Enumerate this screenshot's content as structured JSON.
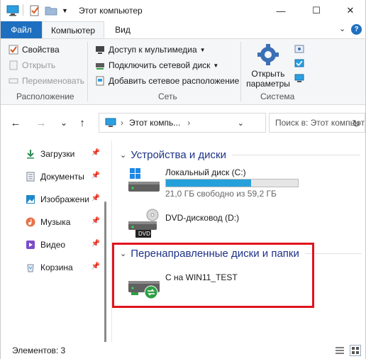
{
  "window": {
    "title": "Этот компьютер",
    "min_glyph": "—",
    "max_glyph": "☐",
    "close_glyph": "✕"
  },
  "ribbon_tabs": {
    "file": "Файл",
    "computer": "Компьютер",
    "view": "Вид",
    "collapse_glyph": "⌄",
    "help_glyph": "?"
  },
  "ribbon": {
    "location": {
      "properties": "Свойства",
      "open": "Открыть",
      "rename": "Переименовать",
      "label": "Расположение"
    },
    "network": {
      "media_access": "Доступ к мультимедиа",
      "map_drive": "Подключить сетевой диск",
      "add_location": "Добавить сетевое расположение",
      "label": "Сеть"
    },
    "system": {
      "open_settings_line1": "Открыть",
      "open_settings_line2": "параметры",
      "label": "Система"
    }
  },
  "nav": {
    "back_glyph": "←",
    "forward_glyph": "→",
    "recent_glyph": "⌄",
    "up_glyph": "↑",
    "address_text": "Этот компь...",
    "address_sep": "›",
    "address_dropdown": "⌄",
    "refresh_glyph": "↻",
    "search_placeholder": "Поиск в: Этот компьютер"
  },
  "navpane": {
    "items": [
      {
        "label": "Загрузки",
        "icon": "downloads-icon"
      },
      {
        "label": "Документы",
        "icon": "documents-icon"
      },
      {
        "label": "Изображения",
        "icon": "pictures-icon"
      },
      {
        "label": "Музыка",
        "icon": "music-icon"
      },
      {
        "label": "Видео",
        "icon": "video-icon"
      },
      {
        "label": "Корзина",
        "icon": "recycle-bin-icon"
      }
    ],
    "pin_glyph": "📌"
  },
  "content": {
    "devices_header": "Устройства и диски",
    "redirected_header": "Перенаправленные диски и папки",
    "chevron": "⌄",
    "drives": [
      {
        "name": "Локальный диск (C:)",
        "free_text": "21,0 ГБ свободно из 59,2 ГБ",
        "used_fraction": 0.645
      },
      {
        "name": "DVD-дисковод (D:)",
        "label": "DVD"
      }
    ],
    "redirected": [
      {
        "name": "C на WIN11_TEST"
      }
    ]
  },
  "status": {
    "items_count": "Элементов: 3"
  },
  "colors": {
    "accent": "#1e6fbf",
    "header_text": "#1e3287",
    "highlight_box": "#e0141e",
    "drive_bar": "#26a0da"
  }
}
